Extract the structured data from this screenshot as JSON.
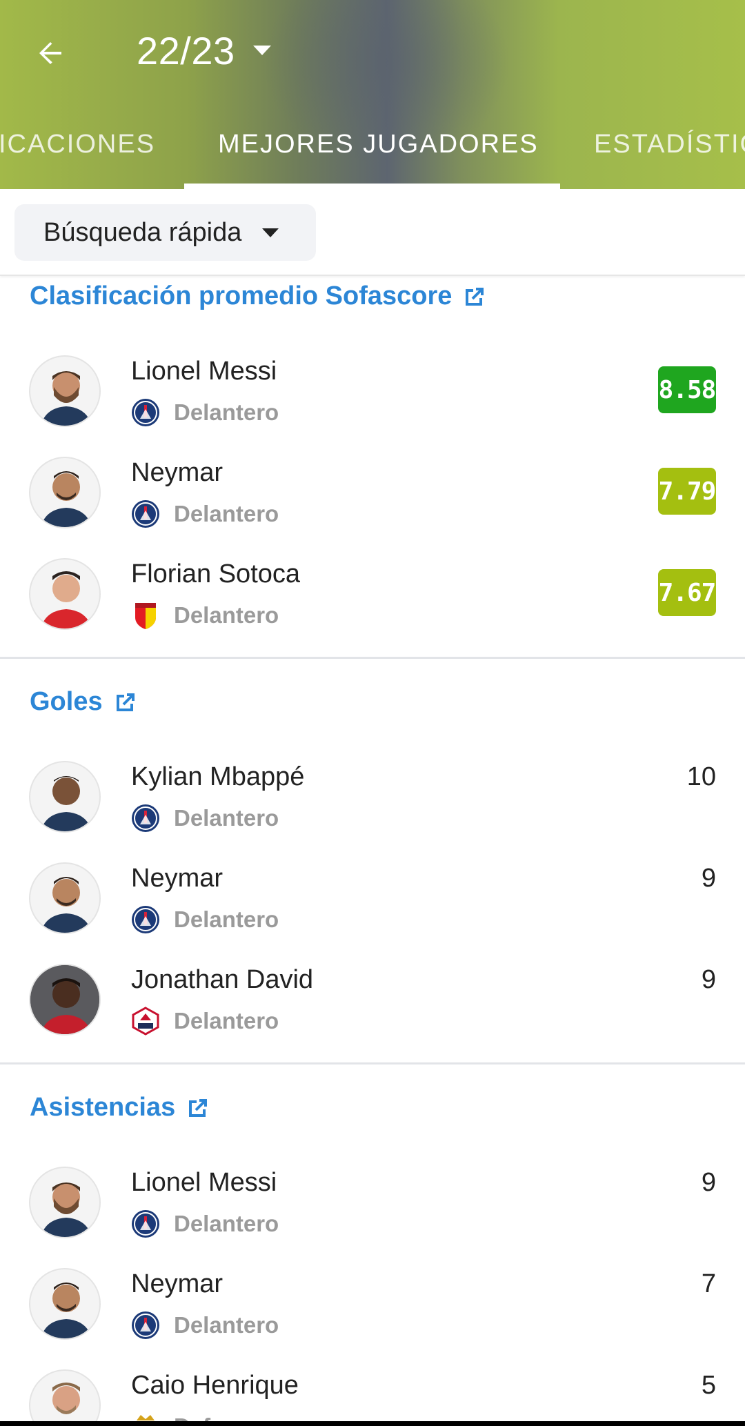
{
  "header": {
    "back_icon": "arrow-left-icon",
    "season": "22/23",
    "season_dropdown_icon": "caret-down-icon",
    "tabs": [
      {
        "label": "ICACIONES",
        "active": false
      },
      {
        "label": "MEJORES JUGADORES",
        "active": true
      },
      {
        "label": "ESTADÍSTIC",
        "active": false
      }
    ],
    "gradient_colors": [
      "#a2b949",
      "#5d6570",
      "#a6bf4a"
    ]
  },
  "filter": {
    "quick_search_label": "Búsqueda rápida",
    "dropdown_icon": "caret-down-icon"
  },
  "sections": [
    {
      "title": "Clasificación promedio Sofascore",
      "link_icon": "external-link-icon",
      "players": [
        {
          "name": "Lionel Messi",
          "position": "Delantero",
          "club": "PSG",
          "value": "8.58",
          "badge_color": "#1fa61f"
        },
        {
          "name": "Neymar",
          "position": "Delantero",
          "club": "PSG",
          "value": "7.79",
          "badge_color": "#a4bf10"
        },
        {
          "name": "Florian Sotoca",
          "position": "Delantero",
          "club": "Lens",
          "value": "7.67",
          "badge_color": "#a4bf10"
        }
      ]
    },
    {
      "title": "Goles",
      "link_icon": "external-link-icon",
      "players": [
        {
          "name": "Kylian Mbappé",
          "position": "Delantero",
          "club": "PSG",
          "value": "10"
        },
        {
          "name": "Neymar",
          "position": "Delantero",
          "club": "PSG",
          "value": "9"
        },
        {
          "name": "Jonathan David",
          "position": "Delantero",
          "club": "Lille",
          "value": "9"
        }
      ]
    },
    {
      "title": "Asistencias",
      "link_icon": "external-link-icon",
      "players": [
        {
          "name": "Lionel Messi",
          "position": "Delantero",
          "club": "PSG",
          "value": "9"
        },
        {
          "name": "Neymar",
          "position": "Delantero",
          "club": "PSG",
          "value": "7"
        },
        {
          "name": "Caio Henrique",
          "position": "Defensa",
          "club": "Monaco",
          "value": "5"
        }
      ]
    }
  ],
  "colors": {
    "accent_link": "#2c86d6",
    "rating_top": "#1fa61f",
    "rating_good": "#a4bf10"
  }
}
